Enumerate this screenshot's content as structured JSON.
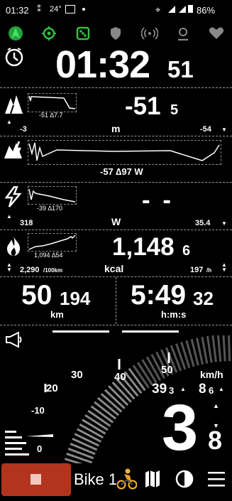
{
  "status_bar": {
    "time": "01:32",
    "temp": "24°",
    "battery": "86%"
  },
  "top_icons": [
    "navigation-arrow-icon",
    "target-icon",
    "dice-icon",
    "shield-icon",
    "signal-waves-icon",
    "user-icon",
    "heart-icon"
  ],
  "clock": {
    "hm": "01:32",
    "sec": "51"
  },
  "elevation": {
    "main": "-51",
    "dec": "5",
    "unit": "m",
    "min": "-3",
    "max": "-54",
    "graph_label": "-51 ∆7.7"
  },
  "power_avg": {
    "graph_label": "-57 ∆97 W"
  },
  "power": {
    "main": "- -",
    "unit": "W",
    "left": "318",
    "right": "35.4",
    "graph_label": "-39 ∆170"
  },
  "calories": {
    "main": "1,148",
    "dec": "6",
    "unit": "kcal",
    "left": "2,290",
    "left_unit": "/100km",
    "right": "197",
    "right_unit": "/h",
    "graph_label": "1,094 ∆54"
  },
  "distance": {
    "main": "50",
    "dec": "194",
    "unit": "km"
  },
  "duration": {
    "main": "5:49",
    "dec": "32",
    "unit": "h:m:s"
  },
  "speedo": {
    "ticks": [
      "10",
      "20",
      "30",
      "40",
      "50"
    ],
    "zero": "0",
    "minus10": "-10",
    "unit": "km/h",
    "avg": "39",
    "avg_dec": "3",
    "max": "8",
    "max_dec": "6",
    "gear_big": "3",
    "gear_small": "8"
  },
  "bottom_bar": {
    "profile": "Bike 1",
    "stop_color": "#b3341c"
  }
}
